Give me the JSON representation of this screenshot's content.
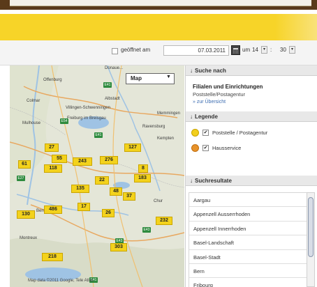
{
  "filter": {
    "open_label": "geöffnet am",
    "date_value": "07.03.2011",
    "um_label": "um",
    "hour_value": "14",
    "colon": ":",
    "minute_value": "30"
  },
  "map": {
    "type_label": "Map",
    "copyright": "Map data ©2011 Google, Tele Atlas",
    "cities": [
      "Offenburg",
      "Donaue...",
      "Albstadt",
      "Colmar",
      "Villingen-Schwenningen",
      "Memmingen",
      "Freiburg im Breisgau",
      "Ravensburg",
      "Mulhouse",
      "Kempten",
      "Bern",
      "Montreux",
      "Chur"
    ],
    "markers": [
      "27",
      "55",
      "243",
      "276",
      "127",
      "61",
      "118",
      "22",
      "183",
      "8",
      "135",
      "48",
      "37",
      "17",
      "486",
      "26",
      "130",
      "232",
      "303",
      "218"
    ],
    "shields": [
      "E41",
      "E54",
      "E41",
      "E43",
      "E43",
      "E27",
      "E41"
    ]
  },
  "panel": {
    "search": {
      "header": "Suche nach",
      "title": "Filialen und Einrichtungen",
      "subtitle": "Poststelle/Postagentur",
      "link": "» zur Übersicht"
    },
    "legend": {
      "header": "Legende",
      "items": [
        {
          "label": "Poststelle / Postagentur",
          "color": "#f2cf1d"
        },
        {
          "label": "Hausservice",
          "color": "#e8932a"
        }
      ]
    },
    "results": {
      "header": "Suchresultate",
      "items": [
        "Aargau",
        "Appenzell Ausserrhoden",
        "Appenzell Innerrhoden",
        "Basel-Landschaft",
        "Basel-Stadt",
        "Bern",
        "Fribourg"
      ]
    }
  },
  "colors": {
    "brand_yellow": "#f7d428",
    "link_blue": "#3a6bb0",
    "marker_yellow": "#f3d21c"
  }
}
